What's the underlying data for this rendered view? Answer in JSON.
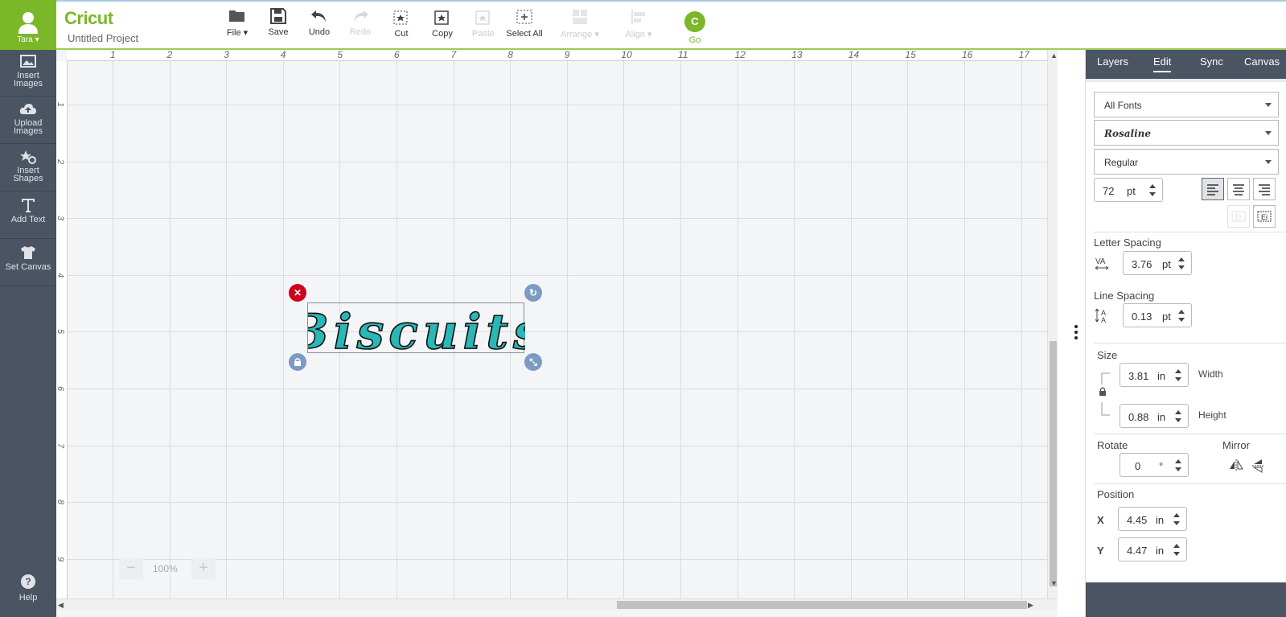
{
  "sidebar": {
    "user_name": "Tara",
    "items": [
      {
        "label": "Insert Images",
        "icon": "image-icon"
      },
      {
        "label": "Upload Images",
        "icon": "cloud-upload-icon"
      },
      {
        "label": "Insert Shapes",
        "icon": "shapes-icon"
      },
      {
        "label": "Add Text",
        "icon": "text-icon"
      },
      {
        "label": "Set Canvas",
        "icon": "tshirt-icon"
      }
    ],
    "help_label": "Help"
  },
  "topbar": {
    "logo": "Cricut",
    "project_name": "Untitled Project",
    "tools": {
      "file": "File",
      "save": "Save",
      "undo": "Undo",
      "redo": "Redo",
      "cut": "Cut",
      "copy": "Copy",
      "paste": "Paste",
      "select_all": "Select All",
      "arrange": "Arrange",
      "align": "Align",
      "go": "Go"
    }
  },
  "canvas": {
    "ruler_h": [
      "1",
      "2",
      "3",
      "4",
      "5",
      "6",
      "7",
      "8",
      "9",
      "10",
      "11",
      "12",
      "13",
      "14",
      "15",
      "16",
      "17"
    ],
    "ruler_v": [
      "1",
      "2",
      "3",
      "4",
      "5",
      "6",
      "7",
      "8",
      "9"
    ],
    "zoom": "100%",
    "text_object": "Biscuits",
    "text_color": "#2ab7b8"
  },
  "panel": {
    "tabs": [
      "Layers",
      "Edit",
      "Sync",
      "Canvas"
    ],
    "active_tab": "Edit",
    "font_filter": "All Fonts",
    "font_name": "Rosaline",
    "font_style": "Regular",
    "font_size": "72",
    "font_size_unit": "pt",
    "letter_spacing_label": "Letter Spacing",
    "letter_spacing": "3.76",
    "letter_spacing_unit": "pt",
    "line_spacing_label": "Line Spacing",
    "line_spacing": "0.13",
    "line_spacing_unit": "pt",
    "size_label": "Size",
    "width": "3.81",
    "width_unit": "in",
    "width_label": "Width",
    "height": "0.88",
    "height_unit": "in",
    "height_label": "Height",
    "rotate_label": "Rotate",
    "rotate": "0",
    "rotate_unit": "°",
    "mirror_label": "Mirror",
    "position_label": "Position",
    "x_label": "X",
    "x": "4.45",
    "x_unit": "in",
    "y_label": "Y",
    "y": "4.47",
    "y_unit": "in"
  },
  "colors": {
    "brand_green": "#7ab829",
    "sidebar_bg": "#4a5462",
    "delete_red": "#d0021b",
    "handle_blue": "#7b9bc4"
  }
}
